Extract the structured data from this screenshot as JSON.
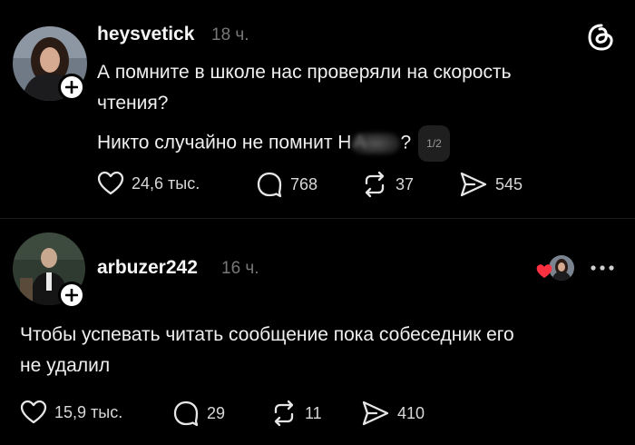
{
  "post1": {
    "username": "heysvetick",
    "time": "18 ч.",
    "line1": "А помните в школе нас проверяли на скорость",
    "line2": "чтения?",
    "line3_before": "Никто случайно не помнит Н",
    "line3_after": "?",
    "line3_blur_tail": "А",
    "page_indicator": "1/2",
    "likes": "24,6 тыс.",
    "comments": "768",
    "reposts": "37",
    "shares": "545"
  },
  "post2": {
    "username": "arbuzer242",
    "time": "16 ч.",
    "line1": "Чтобы успевать читать сообщение пока собеседник его",
    "line2": "не удалил",
    "likes": "15,9 тыс.",
    "comments": "29",
    "reposts": "11",
    "shares": "410"
  },
  "icons": {
    "app": "threads-logo-icon",
    "like": "heart-icon",
    "comment": "comment-bubble-icon",
    "repost": "repost-icon",
    "share": "send-icon",
    "more": "more-dots-icon",
    "liked_by_author": "heart-filled-icon"
  },
  "colors": {
    "background": "#000000",
    "text": "#f0f0f0",
    "muted": "#777777",
    "heart": "#ff3040"
  }
}
